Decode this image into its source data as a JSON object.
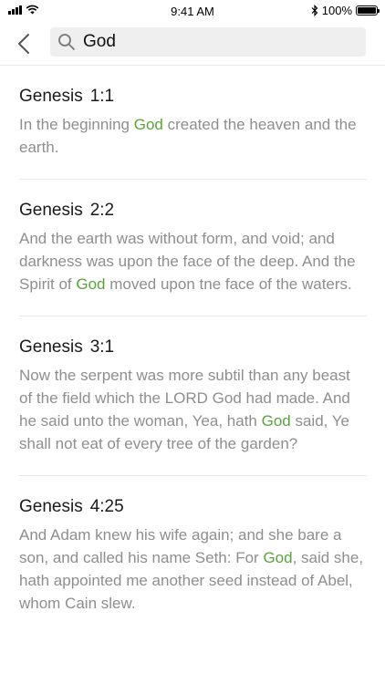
{
  "status_bar": {
    "time": "9:41 AM",
    "battery": "100%",
    "icons": [
      "signal-icon",
      "wifi-icon",
      "bluetooth-icon",
      "battery-icon"
    ]
  },
  "search": {
    "query": "God",
    "icons": [
      "back-chevron-icon",
      "search-icon"
    ]
  },
  "colors": {
    "highlight": "#5aa33c",
    "body_text": "#8e8e8e",
    "reference": "#1a1a1a",
    "search_bg": "#efefef"
  },
  "results": [
    {
      "book": "Genesis",
      "chapter_verse": "1:1",
      "before": "In the beginning ",
      "match": "God",
      "after": " created the heaven and the earth."
    },
    {
      "book": "Genesis",
      "chapter_verse": "2:2",
      "before": "And the earth was without form, and void; and darkness was upon the face of the deep. And the Spirit of ",
      "match": "God",
      "after": " moved upon tne face of the waters."
    },
    {
      "book": "Genesis",
      "chapter_verse": "3:1",
      "before": "Now the serpent was more subtil than any beast of the field which the LORD God had made. And he said unto the woman, Yea, hath ",
      "match": "God",
      "after": " said, Ye shall not eat of every tree of the garden?"
    },
    {
      "book": "Genesis",
      "chapter_verse": "4:25",
      "before": " And Adam knew his wife again; and she bare a son, and called his name Seth: For ",
      "match": "God",
      "after": ", said she, hath appointed me another seed instead of Abel, whom Cain slew."
    }
  ]
}
